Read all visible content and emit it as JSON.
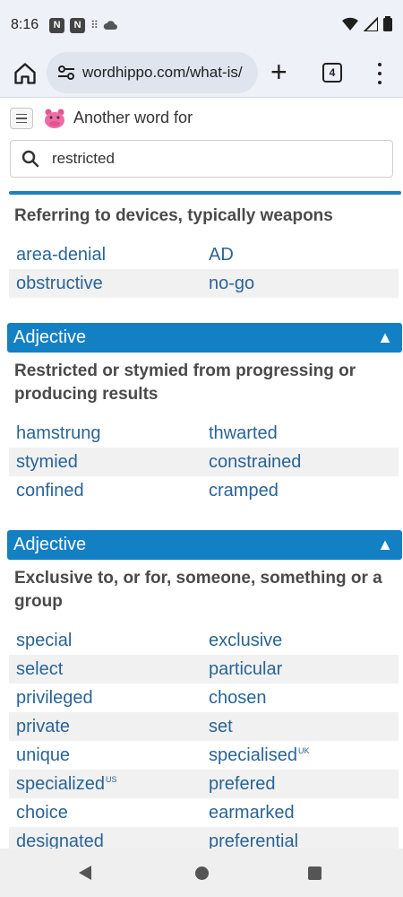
{
  "status": {
    "time": "8:16"
  },
  "browser": {
    "url": "wordhippo.com/what-is/",
    "tab_count": "4"
  },
  "site": {
    "header_title": "Another word for",
    "search": {
      "value": "restricted"
    }
  },
  "sections": [
    {
      "pos": "",
      "definition": "Referring to devices, typically weapons",
      "words": [
        [
          "area-denial",
          "AD"
        ],
        [
          "obstructive",
          "no-go"
        ]
      ]
    },
    {
      "pos": "Adjective",
      "definition": "Restricted or stymied from progressing or producing results",
      "words": [
        [
          "hamstrung",
          "thwarted"
        ],
        [
          "stymied",
          "constrained"
        ],
        [
          "confined",
          "cramped"
        ]
      ]
    },
    {
      "pos": "Adjective",
      "definition": "Exclusive to, or for, someone, something or a group",
      "words": [
        [
          "special",
          "exclusive"
        ],
        [
          "select",
          "particular"
        ],
        [
          "privileged",
          "chosen"
        ],
        [
          "private",
          "set"
        ],
        [
          "unique",
          "specialised"
        ],
        [
          "specialized",
          "prefered"
        ],
        [
          "choice",
          "earmarked"
        ],
        [
          "designated",
          "preferential"
        ]
      ],
      "tags": {
        "specialised": "UK",
        "specialized": "US"
      }
    }
  ],
  "ui": {
    "collapse_glyph": "▲"
  }
}
